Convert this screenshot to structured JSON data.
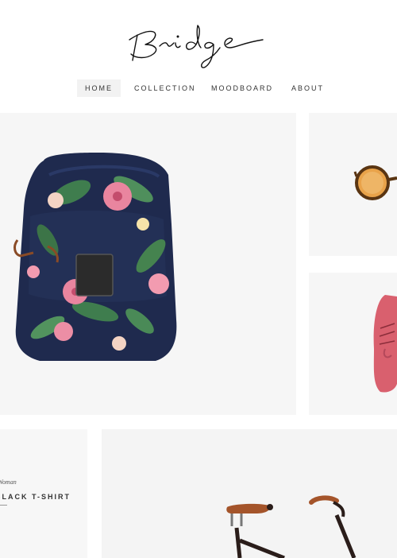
{
  "brand": {
    "logo_text": "Bridge"
  },
  "nav": {
    "items": [
      {
        "label": "HOME",
        "active": true
      },
      {
        "label": "COLLECTION",
        "active": false
      },
      {
        "label": "MOODBOARD",
        "active": false
      },
      {
        "label": "ABOUT",
        "active": false
      }
    ]
  },
  "products": {
    "backpack": {
      "image": "floral-backpack-image"
    },
    "sunglasses": {
      "image": "sunglasses-image"
    },
    "shoe": {
      "image": "pink-shoe-image"
    },
    "tshirt": {
      "category": "Woman",
      "name": "BLACK T-SHIRT"
    },
    "bicycle": {
      "image": "bicycle-image"
    }
  },
  "colors": {
    "backpack_navy": "#1f2a4e",
    "leaf_green": "#3f7d4e",
    "flower_pink": "#e9859f",
    "shoe_pink": "#d9606e",
    "saddle_brown": "#a4542a"
  }
}
